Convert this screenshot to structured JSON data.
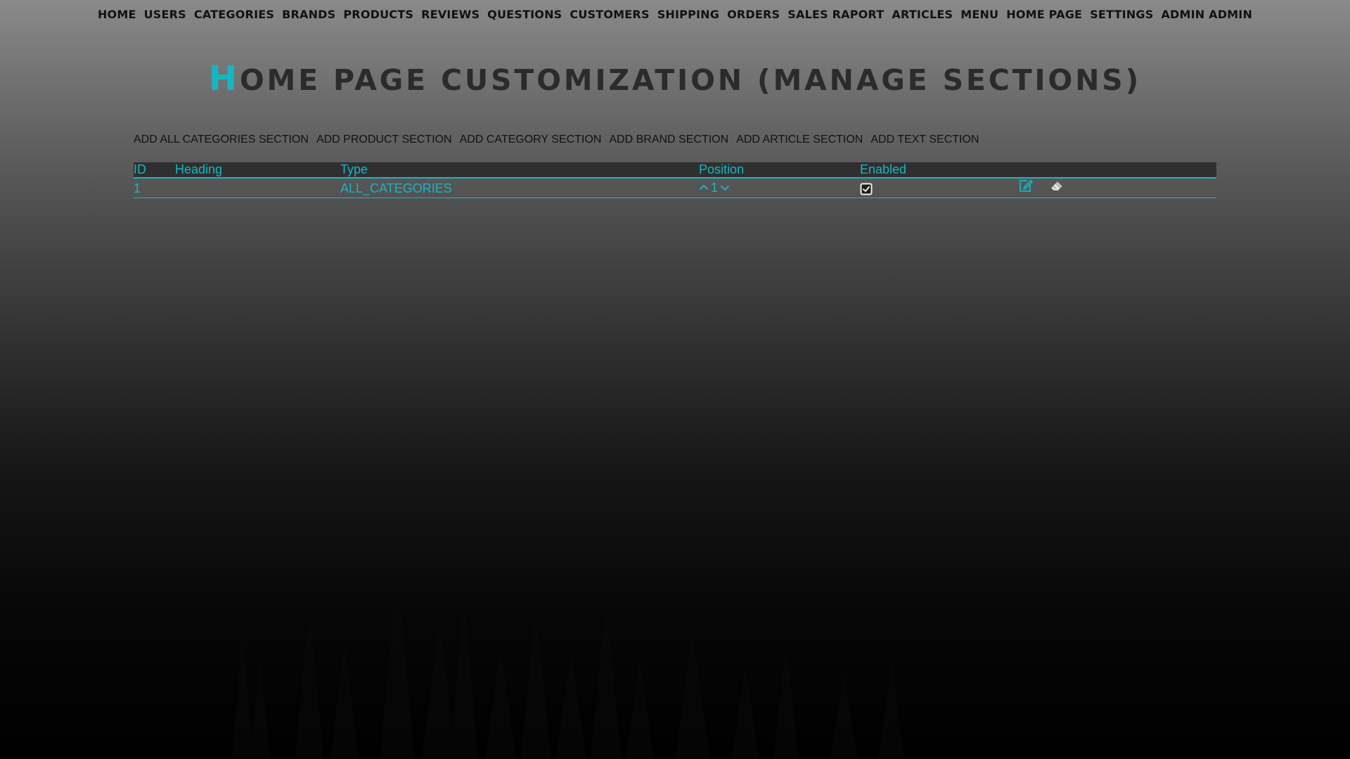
{
  "nav": {
    "items": [
      {
        "label": "HOME"
      },
      {
        "label": "USERS"
      },
      {
        "label": "CATEGORIES"
      },
      {
        "label": "BRANDS"
      },
      {
        "label": "PRODUCTS"
      },
      {
        "label": "REVIEWS"
      },
      {
        "label": "QUESTIONS"
      },
      {
        "label": "CUSTOMERS"
      },
      {
        "label": "SHIPPING"
      },
      {
        "label": "ORDERS"
      },
      {
        "label": "SALES RAPORT"
      },
      {
        "label": "ARTICLES"
      },
      {
        "label": "MENU"
      },
      {
        "label": "HOME PAGE"
      },
      {
        "label": "SETTINGS"
      },
      {
        "label": "ADMIN ADMIN"
      }
    ]
  },
  "page": {
    "title_first_letter": "H",
    "title_rest": "ome Page Customization (Manage Sections)"
  },
  "actions": [
    {
      "label": "ADD ALL CATEGORIES SECTION"
    },
    {
      "label": "ADD PRODUCT SECTION"
    },
    {
      "label": "ADD CATEGORY SECTION"
    },
    {
      "label": "ADD BRAND SECTION"
    },
    {
      "label": "ADD ARTICLE SECTION"
    },
    {
      "label": "ADD TEXT SECTION"
    }
  ],
  "table": {
    "columns": [
      "ID",
      "Heading",
      "Type",
      "Position",
      "Enabled"
    ],
    "rows": [
      {
        "id": "1",
        "heading": "",
        "type": "ALL_CATEGORIES",
        "position": "1",
        "enabled": true
      }
    ]
  },
  "icons": {
    "move_up": "chevron-up-icon",
    "move_down": "chevron-down-icon",
    "enabled": "checkbox-checked-icon",
    "edit": "edit-icon",
    "delete": "eraser-icon"
  },
  "colors": {
    "accent": "#17b6c3",
    "header_row_bg": "#2f2f2f",
    "nav_text": "#111111",
    "title_text": "#2b2b2b"
  }
}
